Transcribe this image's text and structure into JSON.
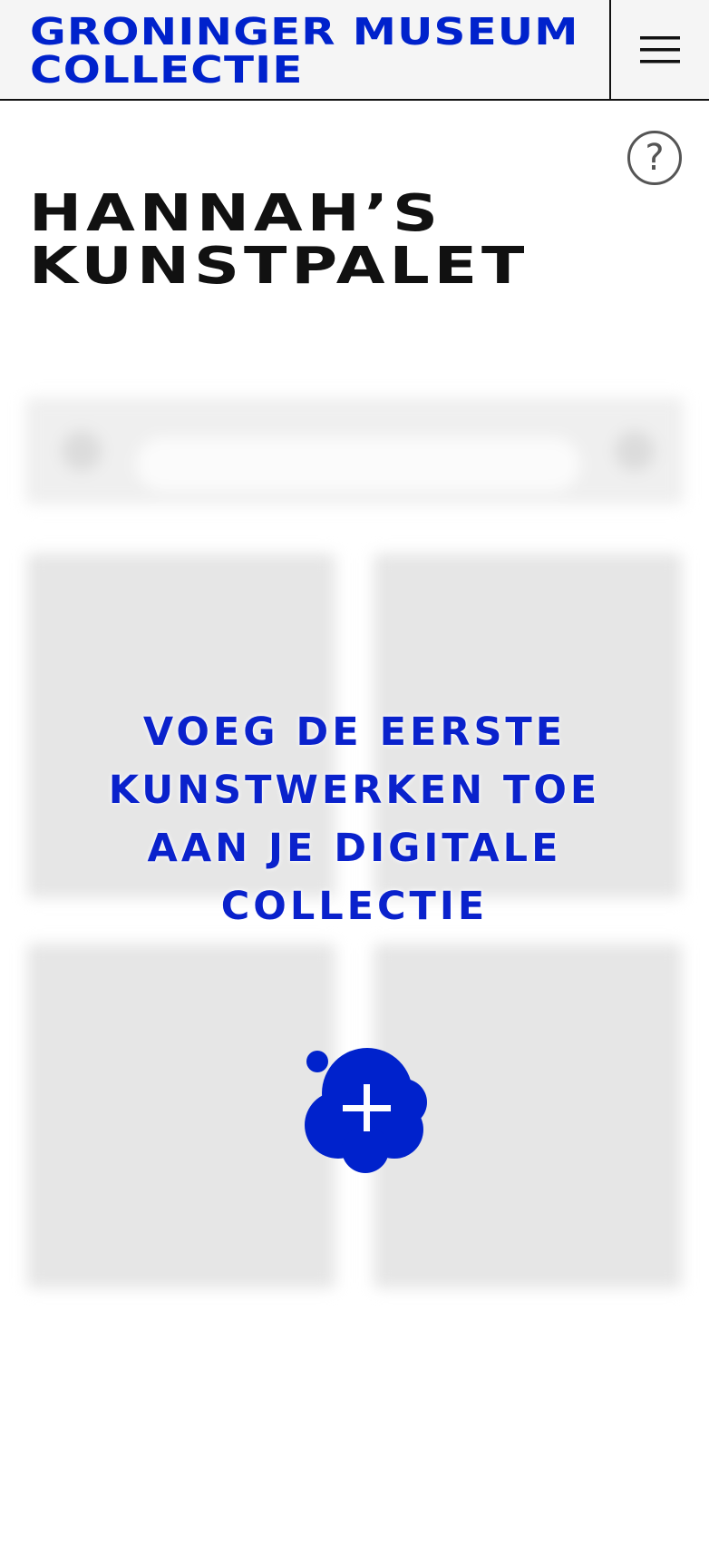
{
  "header": {
    "logo_line1": "GRONINGER MUSEUM",
    "logo_line2": "COLLECTIE",
    "menu_icon": "hamburger-menu-icon"
  },
  "help": {
    "icon": "question-mark-icon",
    "glyph": "?"
  },
  "page": {
    "title_line1": "HANNAH’S",
    "title_line2": "KUNSTPALET"
  },
  "empty_state": {
    "message": "VOEG DE EERSTE KUNSTWERKEN TOE AAN JE DIGITALE COLLECTIE",
    "add_icon": "plus-icon"
  },
  "colors": {
    "brand_blue": "#0022cc",
    "text_dark": "#111111",
    "header_bg": "#f5f5f5"
  }
}
